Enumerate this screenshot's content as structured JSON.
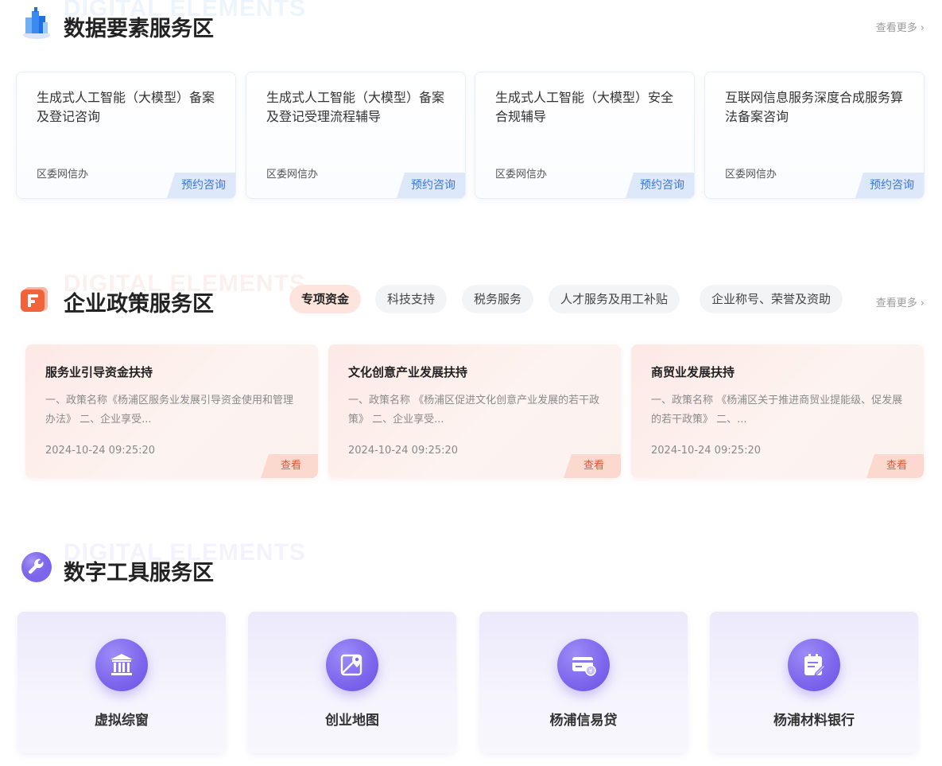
{
  "sections": {
    "data": {
      "ghost_text": "DIGITAL ELEMENTS",
      "title": "数据要素服务区",
      "more_label": "查看更多",
      "colors": {
        "icon": "#3a8bf0",
        "ghost": "#7aa8ee",
        "button_bg": "#dde9fb",
        "button_text": "#3a76e0"
      },
      "cards": [
        {
          "title": "生成式人工智能（大模型）备案及登记咨询",
          "org": "区委网信办",
          "button": "预约咨询"
        },
        {
          "title": "生成式人工智能（大模型）备案及登记受理流程辅导",
          "org": "区委网信办",
          "button": "预约咨询"
        },
        {
          "title": "生成式人工智能（大模型）安全合规辅导",
          "org": "区委网信办",
          "button": "预约咨询"
        },
        {
          "title": "互联网信息服务深度合成服务算法备案咨询",
          "org": "区委网信办",
          "button": "预约咨询"
        }
      ]
    },
    "policy": {
      "ghost_text": "DIGITAL ELEMENTS",
      "title": "企业政策服务区",
      "more_label": "查看更多",
      "colors": {
        "icon": "#f0643c",
        "ghost": "#ee8e7a",
        "active_tab_bg": "#fde4dd",
        "button_text": "#d65a3e"
      },
      "tabs": [
        {
          "label": "专项资金",
          "active": true
        },
        {
          "label": "科技支持",
          "active": false
        },
        {
          "label": "税务服务",
          "active": false
        },
        {
          "label": "人才服务及用工补贴",
          "active": false
        },
        {
          "label": "企业称号、荣誉及资助",
          "active": false
        }
      ],
      "cards": [
        {
          "title": "服务业引导资金扶持",
          "desc": "一、政策名称《杨浦区服务业发展引导资金使用和管理办法》 二、企业享受...",
          "date": "2024-10-24 09:25:20",
          "button": "查看"
        },
        {
          "title": "文化创意产业发展扶持",
          "desc": "一、政策名称 《杨浦区促进文化创意产业发展的若干政策》 二、企业享受...",
          "date": "2024-10-24 09:25:20",
          "button": "查看"
        },
        {
          "title": "商贸业发展扶持",
          "desc": "一、政策名称 《杨浦区关于推进商贸业提能级、促发展的若干政策》 二、...",
          "date": "2024-10-24 09:25:20",
          "button": "查看"
        }
      ]
    },
    "tools": {
      "ghost_text": "DIGITAL ELEMENTS",
      "title": "数字工具服务区",
      "colors": {
        "icon": "#7d65ec",
        "ghost": "#a99af0"
      },
      "cards": [
        {
          "name": "虚拟综窗",
          "icon": "government-building-icon"
        },
        {
          "name": "创业地图",
          "icon": "map-pin-icon"
        },
        {
          "name": "杨浦信易贷",
          "icon": "credit-card-icon"
        },
        {
          "name": "杨浦材料银行",
          "icon": "document-edit-icon"
        }
      ]
    }
  }
}
